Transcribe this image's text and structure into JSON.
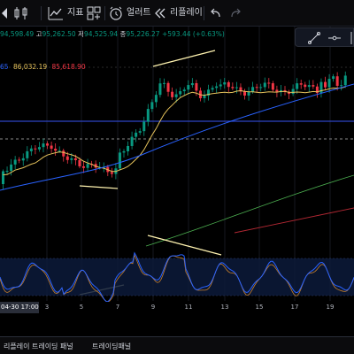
{
  "toolbar": {
    "indicators_label": "지표",
    "alerts_label": "얼러트",
    "replay_label": "리플레이"
  },
  "legend": {
    "ohlc_prefix": "94,598.49",
    "high_label": "고",
    "high_value": "95,262.50",
    "low_label": "저",
    "low_value": "94,525.94",
    "close_label": "종",
    "close_value": "95,226.27",
    "change": "+593.44 (+0.63%)",
    "ma_tail": "65",
    "ma_value_1": "86,032.19",
    "ma_value_2": "85,618.90"
  },
  "xaxis": {
    "highlight": "04-30  17:00",
    "ticks": [
      "3",
      "5",
      "7",
      "9",
      "11",
      "13",
      "15",
      "17",
      "19"
    ]
  },
  "bottom_tabs": {
    "tab1": "리플레이 트레이딩 패널",
    "tab2": "트레이딩패널"
  },
  "colors": {
    "up": "#089981",
    "down": "#f23645",
    "ma_short": "#e6c35c",
    "ma_mid": "#2962ff",
    "ma_long": "#4caf50",
    "ma_longest": "#b22833",
    "hline": "#2e44c4",
    "trend": "#fff3b0",
    "osc": "#2962ff"
  }
}
